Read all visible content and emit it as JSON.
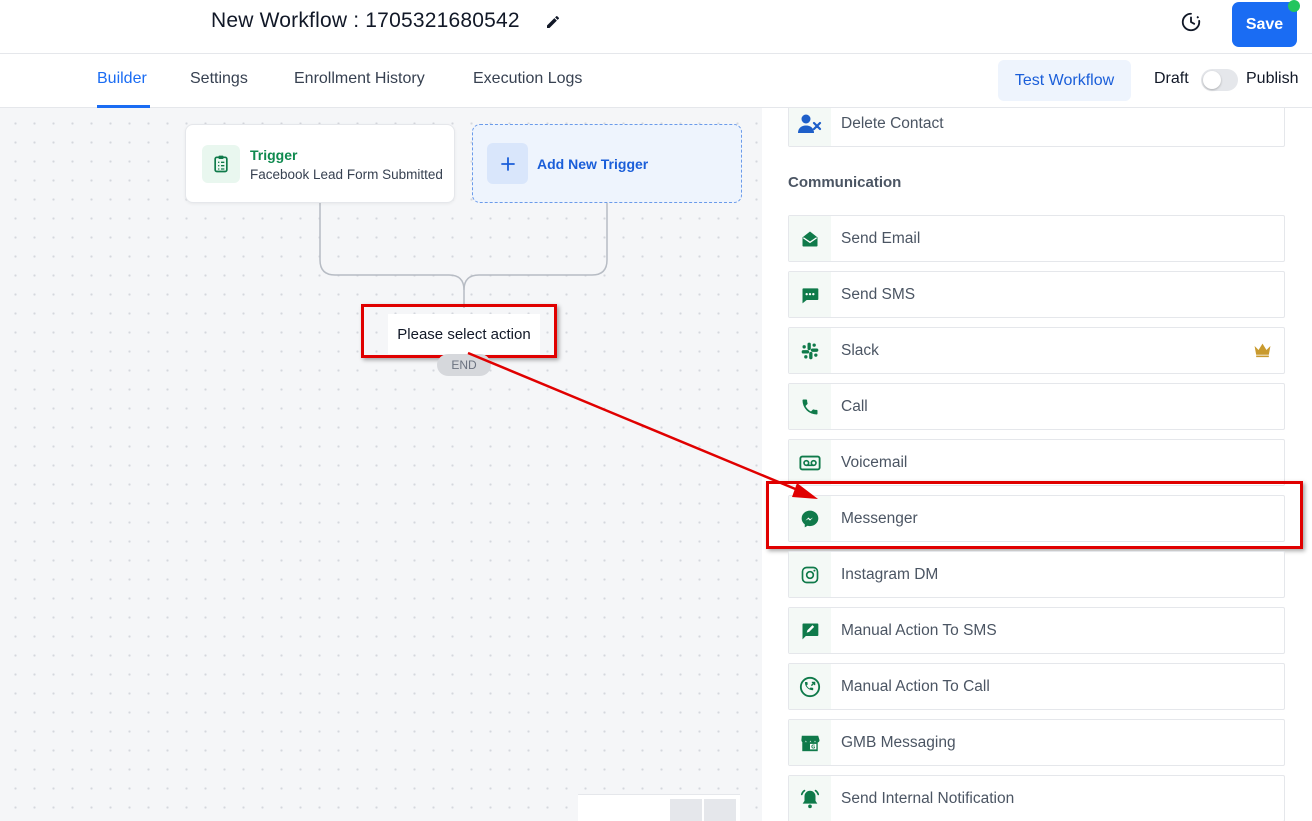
{
  "header": {
    "title": "New Workflow : 1705321680542",
    "save_label": "Save"
  },
  "tabs": {
    "items": [
      {
        "label": "Builder",
        "active": true
      },
      {
        "label": "Settings",
        "active": false
      },
      {
        "label": "Enrollment History",
        "active": false
      },
      {
        "label": "Execution Logs",
        "active": false
      }
    ],
    "test_workflow_label": "Test Workflow",
    "draft_label": "Draft",
    "publish_label": "Publish",
    "published": false
  },
  "canvas": {
    "trigger": {
      "title": "Trigger",
      "subtitle": "Facebook Lead Form Submitted",
      "icon": "clipboard-icon"
    },
    "add_trigger_label": "Add New Trigger",
    "action_placeholder": "Please select action",
    "end_label": "END"
  },
  "panel": {
    "top_item": {
      "label": "Delete Contact",
      "icon": "user-delete-icon"
    },
    "section_title": "Communication",
    "items": [
      {
        "label": "Send Email",
        "icon": "email-icon"
      },
      {
        "label": "Send SMS",
        "icon": "sms-icon"
      },
      {
        "label": "Slack",
        "icon": "slack-icon",
        "premium": true
      },
      {
        "label": "Call",
        "icon": "phone-icon"
      },
      {
        "label": "Voicemail",
        "icon": "voicemail-icon"
      },
      {
        "label": "Messenger",
        "icon": "messenger-icon"
      },
      {
        "label": "Instagram DM",
        "icon": "instagram-icon"
      },
      {
        "label": "Manual Action To SMS",
        "icon": "manual-sms-icon"
      },
      {
        "label": "Manual Action To Call",
        "icon": "manual-call-icon"
      },
      {
        "label": "GMB Messaging",
        "icon": "gmb-icon"
      },
      {
        "label": "Send Internal Notification",
        "icon": "bell-icon"
      }
    ]
  },
  "colors": {
    "primary": "#1a6cf3",
    "accent_green": "#0f7a4a",
    "highlight_red": "#e00000",
    "status_dot": "#22c55e"
  }
}
